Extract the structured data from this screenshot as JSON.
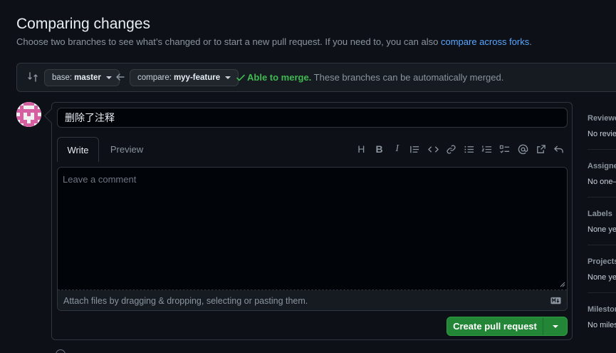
{
  "header": {
    "title": "Comparing changes",
    "subtitle": "Choose two branches to see what’s changed or to start a new pull request. If you need to, you can also ",
    "subtitle_link": "compare across forks",
    "subtitle_end": "."
  },
  "range": {
    "base_prefix": "base:",
    "base_branch": "master",
    "compare_prefix": "compare:",
    "compare_branch": "myy-feature",
    "merge_status": "Able to merge.",
    "merge_detail": " These branches can be automatically merged."
  },
  "form": {
    "title_value": "删除了注释",
    "tab_write": "Write",
    "tab_preview": "Preview",
    "comment_placeholder": "Leave a comment",
    "attach_text": "Attach files by dragging & dropping, selecting or pasting them.",
    "create_button": "Create pull request"
  },
  "toolbar": {
    "heading": "H",
    "bold": "B",
    "italic": "I",
    "icons": [
      "heading-icon",
      "bold-icon",
      "italic-icon",
      "quote-icon",
      "code-icon",
      "link-icon",
      "unordered-list-icon",
      "ordered-list-icon",
      "task-list-icon",
      "mention-icon",
      "reference-icon",
      "reply-icon"
    ]
  },
  "sidebar": {
    "reviewers_label": "Reviewe",
    "reviewers_value": "No revie",
    "assignees_label": "Assignee",
    "assignees_value": "No one—",
    "labels_label": "Labels",
    "labels_value": "None ye",
    "projects_label": "Projects",
    "projects_value": "None ye",
    "milestone_label": "Milestor",
    "milestone_value": "No miles"
  },
  "colors": {
    "background": "#0d1117",
    "accent_link": "#58a6ff",
    "merge_ok": "#3fb950",
    "primary_button": "#238636"
  }
}
